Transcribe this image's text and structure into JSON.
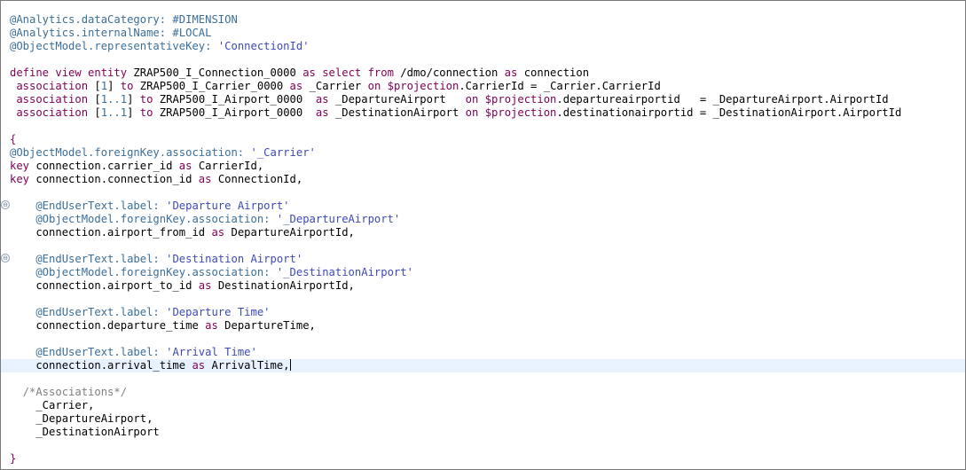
{
  "editor": {
    "lines": [
      {
        "fold": false,
        "current": false,
        "tokens": [
          {
            "t": "ann",
            "v": "@Analytics.dataCategory: #DIMENSION"
          }
        ]
      },
      {
        "fold": false,
        "current": false,
        "tokens": [
          {
            "t": "ann",
            "v": "@Analytics.internalName: #LOCAL"
          }
        ]
      },
      {
        "fold": false,
        "current": false,
        "tokens": [
          {
            "t": "ann",
            "v": "@ObjectModel.representativeKey: "
          },
          {
            "t": "str",
            "v": "'ConnectionId'"
          }
        ]
      },
      {
        "fold": false,
        "current": false,
        "tokens": []
      },
      {
        "fold": false,
        "current": false,
        "tokens": [
          {
            "t": "kw",
            "v": "define view entity "
          },
          {
            "t": "pun",
            "v": "ZRAP500_I_Connection_0000 "
          },
          {
            "t": "kw",
            "v": "as select from "
          },
          {
            "t": "pun",
            "v": "/dmo/connection "
          },
          {
            "t": "kw",
            "v": "as "
          },
          {
            "t": "pun",
            "v": "connection"
          }
        ]
      },
      {
        "fold": false,
        "current": false,
        "tokens": [
          {
            "t": "kw",
            "v": " association "
          },
          {
            "t": "pun",
            "v": "["
          },
          {
            "t": "num",
            "v": "1"
          },
          {
            "t": "pun",
            "v": "] "
          },
          {
            "t": "kw",
            "v": "to "
          },
          {
            "t": "pun",
            "v": "ZRAP500_I_Carrier_0000 "
          },
          {
            "t": "kw",
            "v": "as "
          },
          {
            "t": "pun",
            "v": "_Carrier "
          },
          {
            "t": "kw",
            "v": "on $projection"
          },
          {
            "t": "pun",
            "v": ".CarrierId = _Carrier.CarrierId"
          }
        ]
      },
      {
        "fold": false,
        "current": false,
        "tokens": [
          {
            "t": "kw",
            "v": " association "
          },
          {
            "t": "pun",
            "v": "["
          },
          {
            "t": "num",
            "v": "1..1"
          },
          {
            "t": "pun",
            "v": "] "
          },
          {
            "t": "kw",
            "v": "to "
          },
          {
            "t": "pun",
            "v": "ZRAP500_I_Airport_0000  "
          },
          {
            "t": "kw",
            "v": "as "
          },
          {
            "t": "pun",
            "v": "_DepartureAirport   "
          },
          {
            "t": "kw",
            "v": "on $projection"
          },
          {
            "t": "pun",
            "v": ".departureairportid   = _DepartureAirport.AirportId"
          }
        ]
      },
      {
        "fold": false,
        "current": false,
        "tokens": [
          {
            "t": "kw",
            "v": " association "
          },
          {
            "t": "pun",
            "v": "["
          },
          {
            "t": "num",
            "v": "1..1"
          },
          {
            "t": "pun",
            "v": "] "
          },
          {
            "t": "kw",
            "v": "to "
          },
          {
            "t": "pun",
            "v": "ZRAP500_I_Airport_0000  "
          },
          {
            "t": "kw",
            "v": "as "
          },
          {
            "t": "pun",
            "v": "_DestinationAirport "
          },
          {
            "t": "kw",
            "v": "on $projection"
          },
          {
            "t": "pun",
            "v": ".destinationairportid = _DestinationAirport.AirportId"
          }
        ]
      },
      {
        "fold": false,
        "current": false,
        "tokens": []
      },
      {
        "fold": false,
        "current": false,
        "tokens": [
          {
            "t": "brace",
            "v": "{"
          }
        ]
      },
      {
        "fold": false,
        "current": false,
        "tokens": [
          {
            "t": "ann",
            "v": "@ObjectModel.foreignKey.association: "
          },
          {
            "t": "str",
            "v": "'_Carrier'"
          }
        ]
      },
      {
        "fold": false,
        "current": false,
        "tokens": [
          {
            "t": "kw",
            "v": "key "
          },
          {
            "t": "pun",
            "v": "connection.carrier_id "
          },
          {
            "t": "kw",
            "v": "as "
          },
          {
            "t": "pun",
            "v": "CarrierId,"
          }
        ]
      },
      {
        "fold": false,
        "current": false,
        "tokens": [
          {
            "t": "kw",
            "v": "key "
          },
          {
            "t": "pun",
            "v": "connection.connection_id "
          },
          {
            "t": "kw",
            "v": "as "
          },
          {
            "t": "pun",
            "v": "ConnectionId,"
          }
        ]
      },
      {
        "fold": false,
        "current": false,
        "tokens": []
      },
      {
        "fold": true,
        "current": false,
        "tokens": [
          {
            "t": "ann",
            "v": "    @EndUserText.label: "
          },
          {
            "t": "str",
            "v": "'Departure Airport'"
          }
        ]
      },
      {
        "fold": false,
        "current": false,
        "tokens": [
          {
            "t": "ann",
            "v": "    @ObjectModel.foreignKey.association: "
          },
          {
            "t": "str",
            "v": "'_DepartureAirport'"
          }
        ]
      },
      {
        "fold": false,
        "current": false,
        "tokens": [
          {
            "t": "pun",
            "v": "    connection.airport_from_id "
          },
          {
            "t": "kw",
            "v": "as "
          },
          {
            "t": "pun",
            "v": "DepartureAirportId,"
          }
        ]
      },
      {
        "fold": false,
        "current": false,
        "tokens": []
      },
      {
        "fold": true,
        "current": false,
        "tokens": [
          {
            "t": "ann",
            "v": "    @EndUserText.label: "
          },
          {
            "t": "str",
            "v": "'Destination Airport'"
          }
        ]
      },
      {
        "fold": false,
        "current": false,
        "tokens": [
          {
            "t": "ann",
            "v": "    @ObjectModel.foreignKey.association: "
          },
          {
            "t": "str",
            "v": "'_DestinationAirport'"
          }
        ]
      },
      {
        "fold": false,
        "current": false,
        "tokens": [
          {
            "t": "pun",
            "v": "    connection.airport_to_id "
          },
          {
            "t": "kw",
            "v": "as "
          },
          {
            "t": "pun",
            "v": "DestinationAirportId,"
          }
        ]
      },
      {
        "fold": false,
        "current": false,
        "tokens": []
      },
      {
        "fold": false,
        "current": false,
        "tokens": [
          {
            "t": "ann",
            "v": "    @EndUserText.label: "
          },
          {
            "t": "str",
            "v": "'Departure Time'"
          }
        ]
      },
      {
        "fold": false,
        "current": false,
        "tokens": [
          {
            "t": "pun",
            "v": "    connection.departure_time "
          },
          {
            "t": "kw",
            "v": "as "
          },
          {
            "t": "pun",
            "v": "DepartureTime,"
          }
        ]
      },
      {
        "fold": false,
        "current": false,
        "tokens": []
      },
      {
        "fold": false,
        "current": false,
        "tokens": [
          {
            "t": "ann",
            "v": "    @EndUserText.label: "
          },
          {
            "t": "str",
            "v": "'Arrival Time'"
          }
        ]
      },
      {
        "fold": false,
        "current": true,
        "caret": true,
        "tokens": [
          {
            "t": "pun",
            "v": "    connection.arrival_time "
          },
          {
            "t": "kw",
            "v": "as "
          },
          {
            "t": "pun",
            "v": "ArrivalTime,"
          }
        ]
      },
      {
        "fold": false,
        "current": false,
        "tokens": []
      },
      {
        "fold": false,
        "current": false,
        "tokens": [
          {
            "t": "cmt",
            "v": "  /*Associations*/"
          }
        ]
      },
      {
        "fold": false,
        "current": false,
        "tokens": [
          {
            "t": "pun",
            "v": "    _Carrier,"
          }
        ]
      },
      {
        "fold": false,
        "current": false,
        "tokens": [
          {
            "t": "pun",
            "v": "    _DepartureAirport,"
          }
        ]
      },
      {
        "fold": false,
        "current": false,
        "tokens": [
          {
            "t": "pun",
            "v": "    _DestinationAirport"
          }
        ]
      },
      {
        "fold": false,
        "current": false,
        "tokens": []
      },
      {
        "fold": false,
        "current": false,
        "tokens": [
          {
            "t": "brace",
            "v": "}"
          }
        ]
      }
    ],
    "fold_glyph": "⊖"
  }
}
